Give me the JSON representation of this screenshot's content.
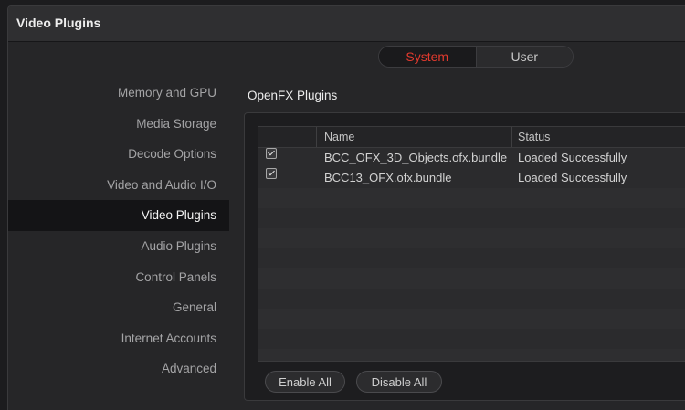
{
  "window": {
    "title": "Video Plugins"
  },
  "tabs": [
    {
      "label": "System",
      "active": true
    },
    {
      "label": "User",
      "active": false
    }
  ],
  "sidebar": {
    "items": [
      {
        "label": "Memory and GPU"
      },
      {
        "label": "Media Storage"
      },
      {
        "label": "Decode Options"
      },
      {
        "label": "Video and Audio I/O"
      },
      {
        "label": "Video Plugins",
        "active": true
      },
      {
        "label": "Audio Plugins"
      },
      {
        "label": "Control Panels"
      },
      {
        "label": "General"
      },
      {
        "label": "Internet Accounts"
      },
      {
        "label": "Advanced"
      }
    ]
  },
  "plugins": {
    "section_title": "OpenFX Plugins",
    "columns": {
      "name": "Name",
      "status": "Status"
    },
    "rows": [
      {
        "checked": true,
        "name": "BCC_OFX_3D_Objects.ofx.bundle",
        "status": "Loaded Successfully"
      },
      {
        "checked": true,
        "name": "BCC13_OFX.ofx.bundle",
        "status": "Loaded Successfully"
      }
    ],
    "buttons": {
      "enable_all": "Enable All",
      "disable_all": "Disable All"
    }
  },
  "colors": {
    "accent": "#e23a2e",
    "background": "#262628",
    "selected_row": "#141416"
  }
}
